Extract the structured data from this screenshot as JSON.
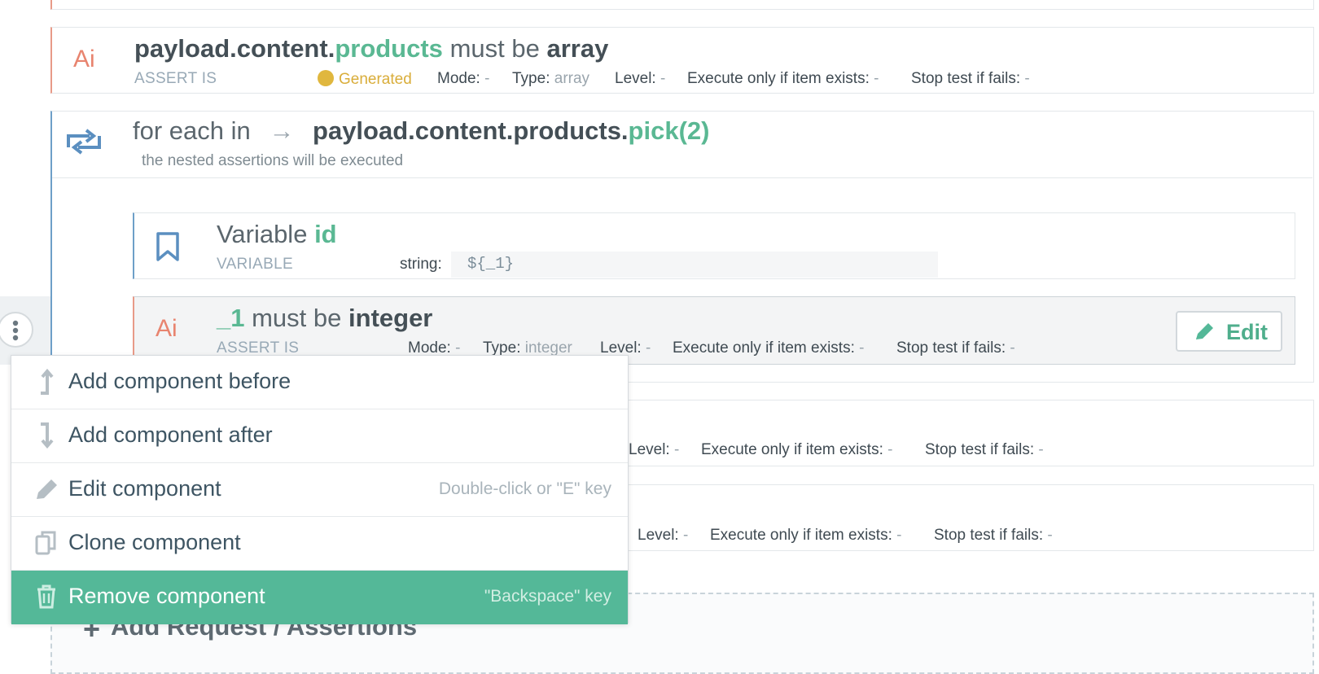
{
  "top_partial": {
    "text": ""
  },
  "assert_products": {
    "icon": "Ai",
    "path_prefix": "payload.content.",
    "path_field": "products",
    "verb": "must be",
    "type_word": "array",
    "kind": "ASSERT IS",
    "generated": "Generated",
    "mode_label": "Mode:",
    "mode_value": "-",
    "type_label": "Type:",
    "type_value": "array",
    "level_label": "Level:",
    "level_value": "-",
    "exec_label": "Execute only if item exists:",
    "exec_value": "-",
    "stop_label": "Stop test if fails:",
    "stop_value": "-"
  },
  "foreach": {
    "icon": "loop-icon",
    "prefix": "for each in",
    "arrow": "→",
    "path_prefix": "payload.content.products.",
    "path_fn": "pick(2)",
    "subtitle": "the nested assertions will be executed"
  },
  "variable": {
    "icon": "bookmark-icon",
    "prefix": "Variable",
    "name": "id",
    "kind": "VARIABLE",
    "string_label": "string:",
    "string_value": "${_1}"
  },
  "assert_id": {
    "icon": "Ai",
    "field": "_1",
    "verb": "must be",
    "type_word": "integer",
    "kind": "ASSERT IS",
    "mode_label": "Mode:",
    "mode_value": "-",
    "type_label": "Type:",
    "type_value": "integer",
    "level_label": "Level:",
    "level_value": "-",
    "exec_label": "Execute only if item exists:",
    "exec_value": "-",
    "stop_label": "Stop test if fails:",
    "stop_value": "-",
    "edit_label": "Edit"
  },
  "row_a": {
    "level_label": "Level:",
    "level_value": "-",
    "exec_label": "Execute only if item exists:",
    "exec_value": "-",
    "stop_label": "Stop test if fails:",
    "stop_value": "-"
  },
  "row_b": {
    "level_label": "Level:",
    "level_value": "-",
    "exec_label": "Execute only if item exists:",
    "exec_value": "-",
    "stop_label": "Stop test if fails:",
    "stop_value": "-"
  },
  "add_request": {
    "label": "Add Request / Assertions"
  },
  "context_menu": {
    "items": [
      {
        "label": "Add component before",
        "hint": "",
        "icon": "arrow-up-icon"
      },
      {
        "label": "Add component after",
        "hint": "",
        "icon": "arrow-down-icon"
      },
      {
        "label": "Edit component",
        "hint": "Double-click or \"E\" key",
        "icon": "pencil-icon"
      },
      {
        "label": "Clone component",
        "hint": "",
        "icon": "clone-icon"
      },
      {
        "label": "Remove component",
        "hint": "\"Backspace\" key",
        "icon": "trash-icon"
      }
    ]
  },
  "colors": {
    "accent_green": "#54b898",
    "assert_red": "#e8846f",
    "loop_blue": "#6e9fc8",
    "generated_gold": "#d9ad3a"
  }
}
